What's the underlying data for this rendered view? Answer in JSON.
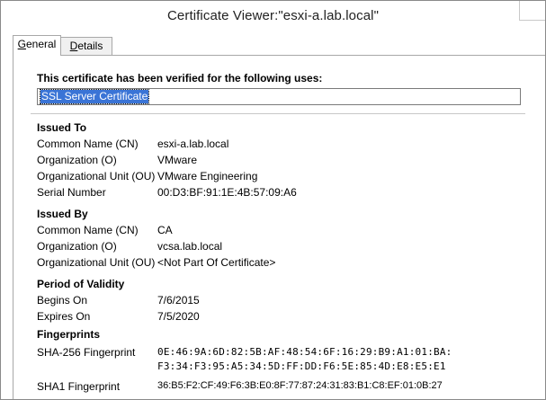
{
  "window": {
    "title": "Certificate Viewer:\"esxi-a.lab.local\""
  },
  "tabs": [
    {
      "label": "General",
      "accel": "G",
      "rest": "eneral"
    },
    {
      "label": "Details",
      "accel": "D",
      "rest": "etails"
    }
  ],
  "general": {
    "verified_heading": "This certificate has been verified for the following uses:",
    "uses": [
      "SSL Server Certificate"
    ],
    "issued_to": {
      "heading": "Issued To",
      "rows": [
        {
          "label": "Common Name (CN)",
          "value": "esxi-a.lab.local"
        },
        {
          "label": "Organization (O)",
          "value": "VMware"
        },
        {
          "label": "Organizational Unit (OU)",
          "value": "VMware Engineering"
        },
        {
          "label": "Serial Number",
          "value": "00:D3:BF:91:1E:4B:57:09:A6"
        }
      ]
    },
    "issued_by": {
      "heading": "Issued By",
      "rows": [
        {
          "label": "Common Name (CN)",
          "value": "CA"
        },
        {
          "label": "Organization (O)",
          "value": "vcsa.lab.local"
        },
        {
          "label": "Organizational Unit (OU)",
          "value": "<Not Part Of Certificate>"
        }
      ]
    },
    "validity": {
      "heading": "Period of Validity",
      "rows": [
        {
          "label": "Begins On",
          "value": "7/6/2015"
        },
        {
          "label": "Expires On",
          "value": "7/5/2020"
        }
      ]
    },
    "fingerprints": {
      "heading": "Fingerprints",
      "sha256_label": "SHA-256 Fingerprint",
      "sha256_line1": "0E:46:9A:6D:82:5B:AF:48:54:6F:16:29:B9:A1:01:BA:",
      "sha256_line2": "F3:34:F3:95:A5:34:5D:FF:DD:F6:5E:85:4D:E8:E5:E1",
      "sha1_label": "SHA1 Fingerprint",
      "sha1_value": "36:B5:F2:CF:49:F6:3B:E0:8F:77:87:24:31:83:B1:C8:EF:01:0B:27"
    }
  }
}
